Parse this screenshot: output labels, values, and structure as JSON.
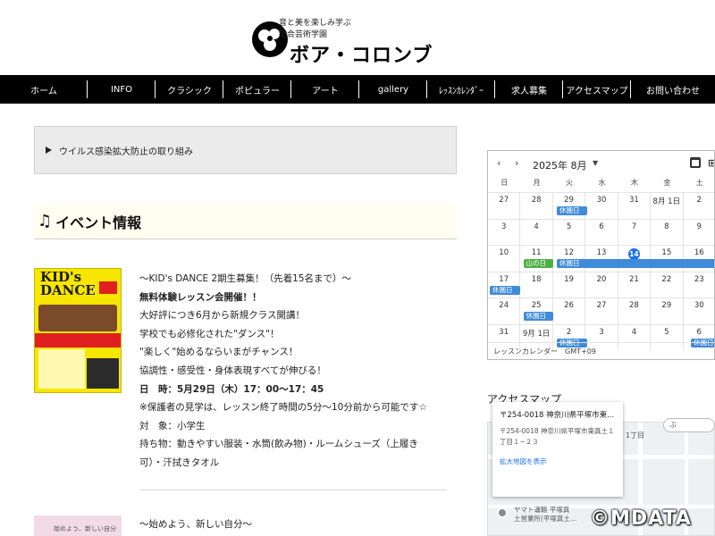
{
  "logo": {
    "tagline1": "音と美を楽しみ学ぶ",
    "tagline2": "総合芸術学園",
    "name": "ボア・コロンブ"
  },
  "nav": {
    "items": [
      {
        "label": "ホーム",
        "w": 38
      },
      {
        "label": "INFO",
        "w": 76
      },
      {
        "label": "クラシック",
        "w": 76
      },
      {
        "label": "ポピュラー",
        "w": 76
      },
      {
        "label": "アート",
        "w": 76
      },
      {
        "label": "gallery",
        "w": 76
      },
      {
        "label": "ﾚｯｽﾝｶﾚﾝﾀﾞｰ",
        "w": 76
      },
      {
        "label": "求人募集",
        "w": 76
      },
      {
        "label": "アクセスマップ",
        "w": 76
      },
      {
        "label": "お問い合わせ",
        "w": 76
      }
    ]
  },
  "notice": {
    "label": "ウイルス感染拡大防止の取り組み"
  },
  "events": {
    "heading": "イベント情報",
    "item1": {
      "flyer_title1": "KID's",
      "flyer_title2": "DANCE",
      "lines": [
        "〜KID's DANCE 2期生募集！（先着15名まで）〜",
        "無料体験レッスン会開催！！",
        "大好評につき6月から新規クラス開講！",
        "学校でも必修化された\"ダンス\"！",
        "\"楽しく\"始めるならいまがチャンス！",
        "協調性・感受性・身体表現すべてが伸びる！",
        "日　時：5月29日（木）17：00〜17：45",
        "※保護者の見学は、レッスン終了時間の5分〜10分前から可能です☆",
        "対　象：小学生",
        "持ち物：動きやすい服装・水筒(飲み物)・ルームシューズ（上履き",
        "可）・汗拭きタオル"
      ]
    },
    "item2": {
      "flyer_text": "始めよう、新しい自分",
      "title": "〜始めよう、新しい自分〜"
    }
  },
  "calendar": {
    "month_label": "2025年 8月",
    "weekdays": [
      "日",
      "月",
      "火",
      "水",
      "木",
      "金",
      "土"
    ],
    "weeks": [
      [
        "27",
        "28",
        "29",
        "30",
        "31",
        "8月 1日",
        "2"
      ],
      [
        "3",
        "4",
        "5",
        "6",
        "7",
        "8",
        "9"
      ],
      [
        "10",
        "11",
        "12",
        "13",
        "14",
        "15",
        "16"
      ],
      [
        "17",
        "18",
        "19",
        "20",
        "21",
        "22",
        "23"
      ],
      [
        "24",
        "25",
        "26",
        "27",
        "28",
        "29",
        "30"
      ],
      [
        "31",
        "9月 1日",
        "2",
        "3",
        "4",
        "5",
        "6"
      ]
    ],
    "today": "14",
    "event_label": "休園日",
    "holiday_label": "山の日",
    "footer": "レッスンカレンダー　GMT+09"
  },
  "access": {
    "heading": "アクセスマップ",
    "card_title": "〒254-0018 神奈川県平塚市東...",
    "card_address1": "〒254-0018 神奈川県平塚市東真土１",
    "card_address2": "丁目１−２３",
    "card_link": "拡大地図を表示",
    "block_label": "1丁目",
    "pin_label1": "ヤマト運輸 平塚真",
    "pin_label2": "土営業所(平塚真土...",
    "chip_label": "ぶ"
  },
  "watermark": "©MDATA",
  "colors": {
    "nav_bg": "#000000",
    "event_blue": "#3f8ad9",
    "holiday_green": "#4fae43",
    "today_blue": "#1a73e8",
    "flyer_yellow": "#f6e600"
  }
}
